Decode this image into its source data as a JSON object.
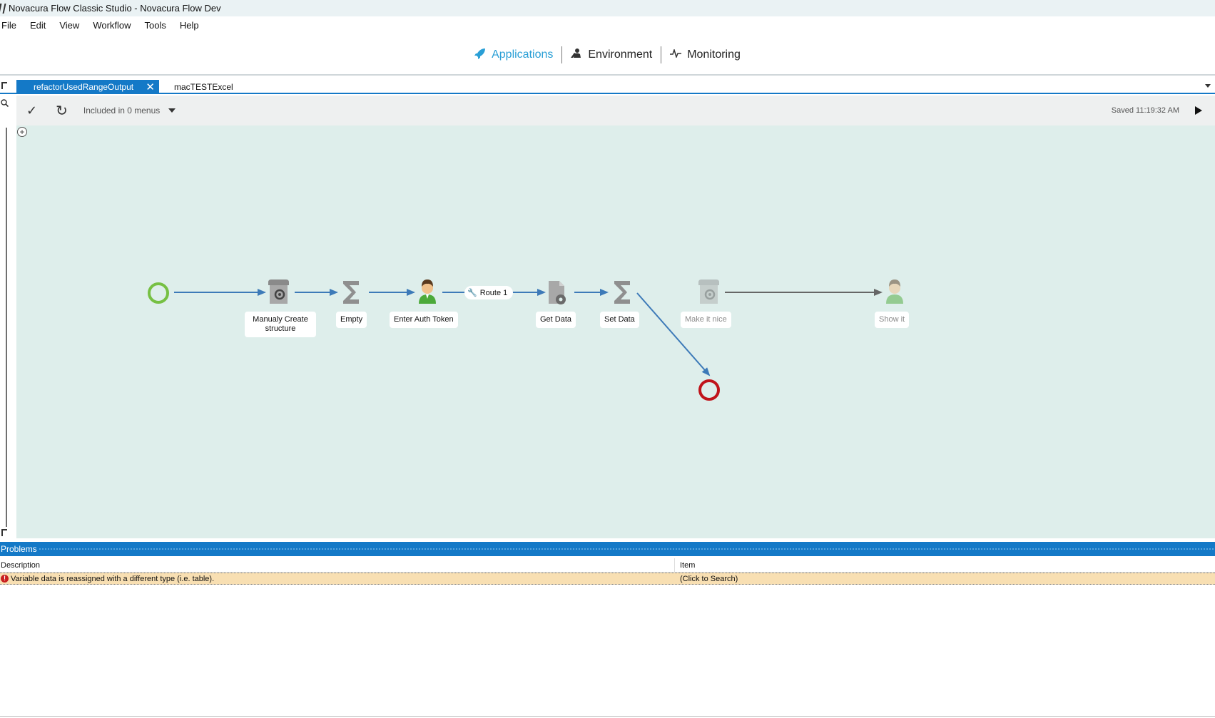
{
  "window": {
    "title": "Novacura Flow Classic Studio - Novacura Flow Dev"
  },
  "menu": [
    "File",
    "Edit",
    "View",
    "Workflow",
    "Tools",
    "Help"
  ],
  "nav": [
    {
      "label": "Applications",
      "icon": "rocket-icon",
      "active": true
    },
    {
      "label": "Environment",
      "icon": "environment-icon",
      "active": false
    },
    {
      "label": "Monitoring",
      "icon": "pulse-icon",
      "active": false
    }
  ],
  "tabs": [
    {
      "label": "refactorUsedRangeOutput",
      "active": true
    },
    {
      "label": "macTESTExcel",
      "active": false
    }
  ],
  "toolbar": {
    "menus_label": "Included in 0 menus",
    "saved": "Saved 11:19:32 AM"
  },
  "flow": {
    "nodes": [
      {
        "label": "Manualy Create structure",
        "type": "script"
      },
      {
        "label": "Empty",
        "type": "sum"
      },
      {
        "label": "Enter Auth Token",
        "type": "user"
      },
      {
        "label": "Get Data",
        "type": "data"
      },
      {
        "label": "Set Data",
        "type": "sum"
      },
      {
        "label": "Make it nice",
        "type": "script",
        "disabled": true
      },
      {
        "label": "Show it",
        "type": "user",
        "disabled": true
      }
    ],
    "route_label": "Route 1",
    "colors": {
      "start": "#76c043",
      "end": "#c0141b",
      "arrow": "#3d7ab8",
      "arrow_disabled": "#666666",
      "canvas": "#deeeeb"
    }
  },
  "problems": {
    "title": "Problems",
    "columns": [
      "Description",
      "Item"
    ],
    "rows": [
      {
        "description": "Variable data is reassigned with a different type (i.e. table).",
        "item": "(Click to Search)"
      }
    ]
  }
}
